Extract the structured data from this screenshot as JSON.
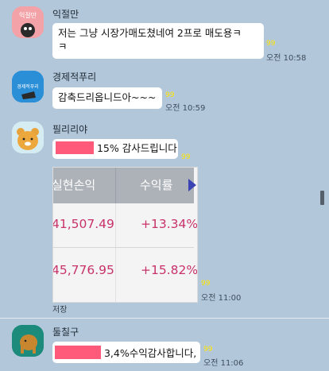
{
  "messages": [
    {
      "sender": "익절만",
      "avatar_text": "익절만",
      "line1": "저는 그냥 시장가매도쳤네여 2프로 매도용ㅋ",
      "line2": "ㅋ",
      "unread": "99",
      "time": "오전 10:58"
    },
    {
      "sender": "경제적푸리",
      "avatar_text": "경제적푸리",
      "text": "감축드리옵니드아~~~",
      "unread": "99",
      "time": "오전 10:59"
    },
    {
      "sender": "필리리야",
      "text": "15% 감사드립니다",
      "unread": "99",
      "table": {
        "headers": [
          "실현손익",
          "수익률"
        ],
        "rows": [
          {
            "pnl": "41,507.49",
            "rate": "+13.34%"
          },
          {
            "pnl": "45,776.95",
            "rate": "+15.82%"
          }
        ]
      },
      "table_unread": "99",
      "table_time": "오전 11:00",
      "saved_label": "저장"
    },
    {
      "sender": "둘칠구",
      "text": "3,4%수익감사합니다,",
      "unread": "99",
      "time": "오전 11:06"
    }
  ],
  "colors": {
    "background": "#b2c7da",
    "bubble": "#ffffff",
    "unread": "#ffe600",
    "redaction": "#ff5a79",
    "profit_text": "#c8326a"
  },
  "icons": [
    "smiley-avatar",
    "newspaper-avatar",
    "ryan-bear-avatar",
    "elephant-avatar",
    "scroll-right-arrow"
  ]
}
